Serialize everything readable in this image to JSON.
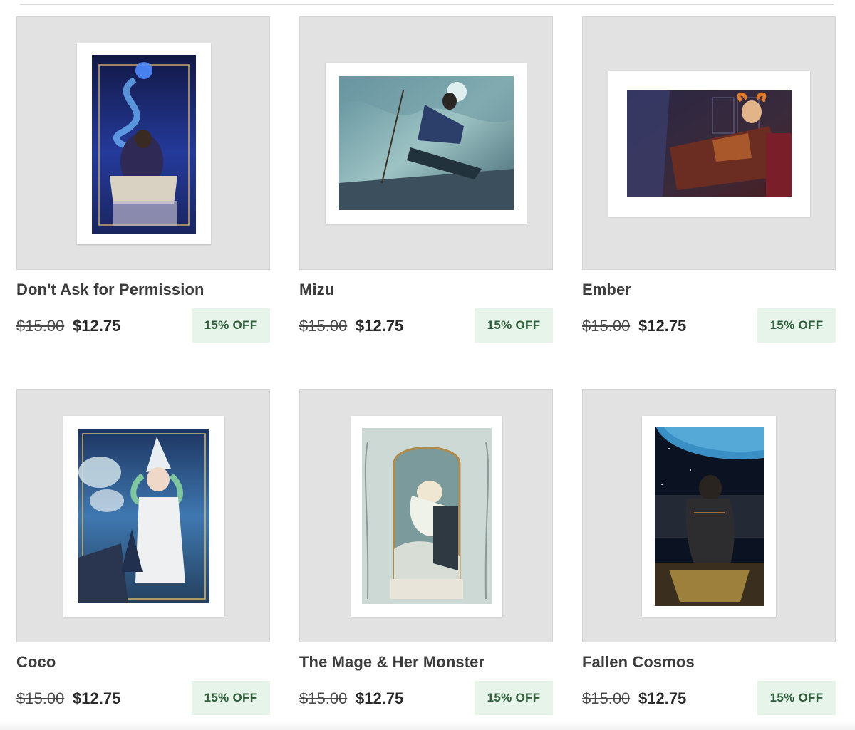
{
  "products": [
    {
      "title": "Don't Ask for Permission",
      "original_price": "$15.00",
      "sale_price": "$12.75",
      "discount_badge": "15% OFF",
      "artwork_colors": [
        "#1a1f5e",
        "#3a5bd6",
        "#6fb8ff",
        "#f1e6d0"
      ]
    },
    {
      "title": "Mizu",
      "original_price": "$15.00",
      "sale_price": "$12.75",
      "discount_badge": "15% OFF",
      "artwork_colors": [
        "#3e6b78",
        "#8fb8bd",
        "#2c3c4d",
        "#c8d8d8"
      ]
    },
    {
      "title": "Ember",
      "original_price": "$15.00",
      "sale_price": "$12.75",
      "discount_badge": "15% OFF",
      "artwork_colors": [
        "#2a2240",
        "#6b2f2a",
        "#d67a3a",
        "#3b3f6e"
      ]
    },
    {
      "title": "Coco",
      "original_price": "$15.00",
      "sale_price": "$12.75",
      "discount_badge": "15% OFF",
      "artwork_colors": [
        "#1f3c6b",
        "#4f8fc4",
        "#cfe0c8",
        "#e8eef0"
      ]
    },
    {
      "title": "The Mage & Her Monster",
      "original_price": "$15.00",
      "sale_price": "$12.75",
      "discount_badge": "15% OFF",
      "artwork_colors": [
        "#b9c9c4",
        "#6c8a8c",
        "#efeae0",
        "#2e3a3e"
      ]
    },
    {
      "title": "Fallen Cosmos",
      "original_price": "$15.00",
      "sale_price": "$12.75",
      "discount_badge": "15% OFF",
      "artwork_colors": [
        "#0a1020",
        "#3a9fd0",
        "#2b2b2b",
        "#c9a24a"
      ]
    }
  ]
}
